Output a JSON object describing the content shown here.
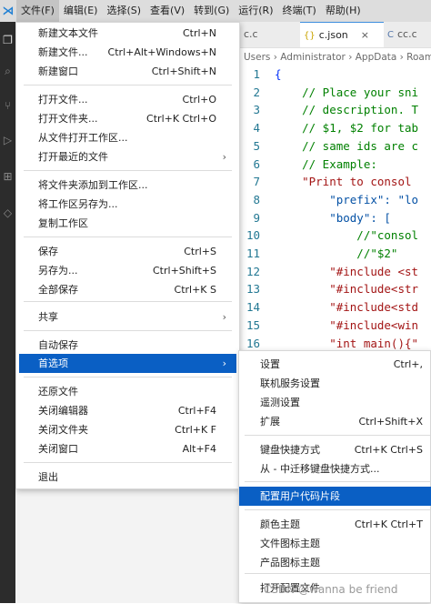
{
  "colors": {
    "accent": "#0a5fc4",
    "menubar_bg": "#dddddd",
    "activity_bar_bg": "#2c2c2c"
  },
  "menubar": {
    "items": [
      {
        "label": "文件(F)"
      },
      {
        "label": "编辑(E)"
      },
      {
        "label": "选择(S)"
      },
      {
        "label": "查看(V)"
      },
      {
        "label": "转到(G)"
      },
      {
        "label": "运行(R)"
      },
      {
        "label": "终端(T)"
      },
      {
        "label": "帮助(H)"
      }
    ]
  },
  "tabs": [
    {
      "label": "c.c"
    },
    {
      "label": "c.json",
      "icon": "{}",
      "close": "×"
    },
    {
      "label": "cc.c",
      "icon": "C"
    }
  ],
  "breadcrumb": "Users › Administrator › AppData › Roami",
  "code_lines": [
    {
      "n": "1",
      "t": "{"
    },
    {
      "n": "2",
      "t": "    // Place your sni"
    },
    {
      "n": "3",
      "t": "    // description. T"
    },
    {
      "n": "4",
      "t": "    // $1, $2 for tab"
    },
    {
      "n": "5",
      "t": "    // same ids are c"
    },
    {
      "n": "6",
      "t": "    // Example:"
    },
    {
      "n": "7",
      "t": "    \"Print to consol"
    },
    {
      "n": "8",
      "t": "        \"prefix\": \"lo"
    },
    {
      "n": "9",
      "t": "        \"body\": ["
    },
    {
      "n": "10",
      "t": "            //\"consol"
    },
    {
      "n": "11",
      "t": "            //\"$2\""
    },
    {
      "n": "12",
      "t": "        \"#include <st"
    },
    {
      "n": "13",
      "t": "        \"#include<str"
    },
    {
      "n": "14",
      "t": "        \"#include<std"
    },
    {
      "n": "15",
      "t": "        \"#include<win"
    },
    {
      "n": "16",
      "t": "        \"int main(){\""
    }
  ],
  "file_menu": {
    "items": [
      {
        "label": "新建文本文件",
        "shortcut": "Ctrl+N"
      },
      {
        "label": "新建文件...",
        "shortcut": "Ctrl+Alt+Windows+N"
      },
      {
        "label": "新建窗口",
        "shortcut": "Ctrl+Shift+N"
      },
      {
        "label": "打开文件...",
        "shortcut": "Ctrl+O"
      },
      {
        "label": "打开文件夹...",
        "shortcut": "Ctrl+K Ctrl+O"
      },
      {
        "label": "从文件打开工作区..."
      },
      {
        "label": "打开最近的文件",
        "arrow": "›"
      },
      {
        "label": "将文件夹添加到工作区..."
      },
      {
        "label": "将工作区另存为..."
      },
      {
        "label": "复制工作区"
      },
      {
        "label": "保存",
        "shortcut": "Ctrl+S"
      },
      {
        "label": "另存为...",
        "shortcut": "Ctrl+Shift+S"
      },
      {
        "label": "全部保存",
        "shortcut": "Ctrl+K S"
      },
      {
        "label": "共享",
        "arrow": "›"
      },
      {
        "label": "自动保存"
      },
      {
        "label": "首选项",
        "arrow": "›"
      },
      {
        "label": "还原文件"
      },
      {
        "label": "关闭编辑器",
        "shortcut": "Ctrl+F4"
      },
      {
        "label": "关闭文件夹",
        "shortcut": "Ctrl+K F"
      },
      {
        "label": "关闭窗口",
        "shortcut": "Alt+F4"
      },
      {
        "label": "退出"
      }
    ]
  },
  "preferences_submenu": {
    "items": [
      {
        "label": "设置",
        "shortcut": "Ctrl+,"
      },
      {
        "label": "联机服务设置"
      },
      {
        "label": "遥测设置"
      },
      {
        "label": "扩展",
        "shortcut": "Ctrl+Shift+X"
      },
      {
        "label": "键盘快捷方式",
        "shortcut": "Ctrl+K Ctrl+S"
      },
      {
        "label": "从 - 中迁移键盘快捷方式..."
      },
      {
        "label": "配置用户代码片段"
      },
      {
        "label": "颜色主题",
        "shortcut": "Ctrl+K Ctrl+T"
      },
      {
        "label": "文件图标主题"
      },
      {
        "label": "产品图标主题"
      },
      {
        "label": "打开配置文件"
      }
    ]
  },
  "watermark": "CSDN @wanna be friend"
}
